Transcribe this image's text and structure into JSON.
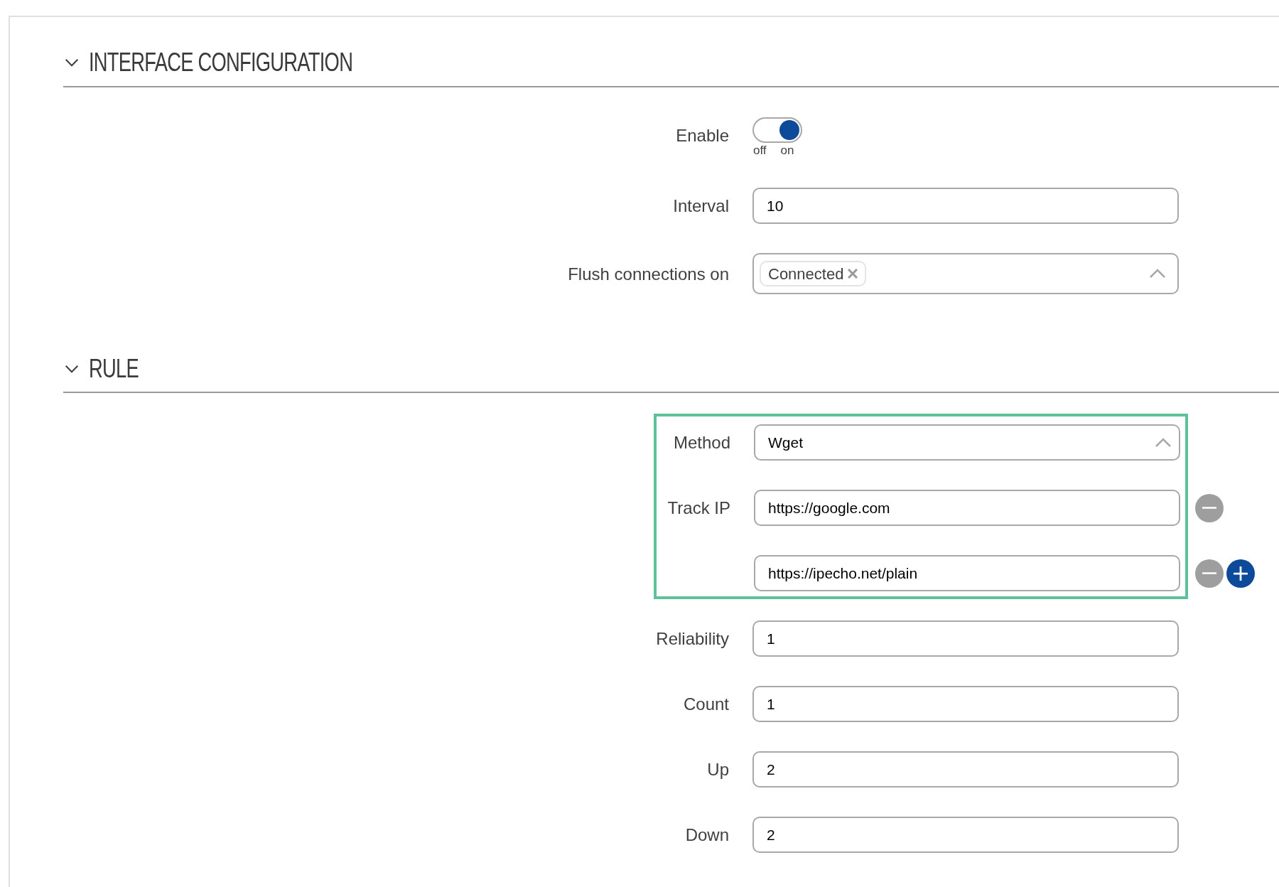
{
  "sections": [
    {
      "title": "INTERFACE CONFIGURATION",
      "expanded": true,
      "fields": [
        {
          "kind": "toggle",
          "label": "Enable",
          "on": true,
          "off_text": "off",
          "on_text": "on"
        },
        {
          "kind": "input",
          "label": "Interval",
          "value": "10"
        },
        {
          "kind": "multiselect",
          "label": "Flush connections on",
          "tags": [
            "Connected"
          ],
          "open": true
        }
      ]
    },
    {
      "title": "RULE",
      "expanded": true,
      "fields": [
        {
          "kind": "group",
          "highlighted": true,
          "fields": [
            {
              "kind": "select",
              "label": "Method",
              "value": "Wget",
              "open": true
            },
            {
              "kind": "list",
              "label": "Track IP",
              "values": [
                "https://google.com",
                "https://ipecho.net/plain"
              ]
            }
          ]
        },
        {
          "kind": "input",
          "label": "Reliability",
          "value": "1"
        },
        {
          "kind": "input",
          "label": "Count",
          "value": "1"
        },
        {
          "kind": "input",
          "label": "Up",
          "value": "2"
        },
        {
          "kind": "input",
          "label": "Down",
          "value": "2"
        }
      ]
    }
  ]
}
